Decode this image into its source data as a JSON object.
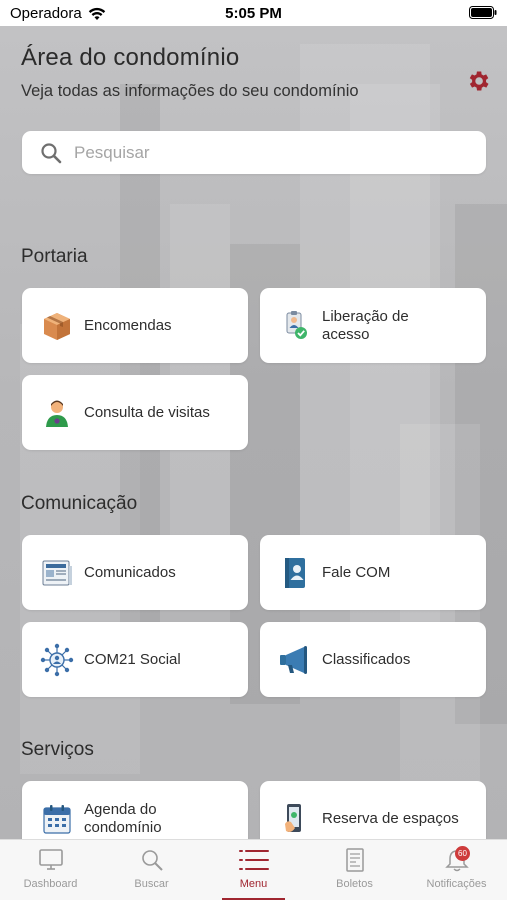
{
  "status_bar": {
    "carrier": "Operadora",
    "time": "5:05 PM"
  },
  "header": {
    "title": "Área do condomínio",
    "subtitle": "Veja todas as informações do seu condomínio"
  },
  "search": {
    "placeholder": "Pesquisar"
  },
  "sections": {
    "portaria": {
      "title": "Portaria",
      "items": [
        {
          "label": "Encomendas",
          "icon": "package-icon"
        },
        {
          "label": "Liberação de acesso",
          "icon": "access-badge-icon"
        },
        {
          "label": "Consulta de visitas",
          "icon": "visitor-icon"
        }
      ]
    },
    "comunicacao": {
      "title": "Comunicação",
      "items": [
        {
          "label": "Comunicados",
          "icon": "newspaper-icon"
        },
        {
          "label": "Fale COM",
          "icon": "contact-book-icon"
        },
        {
          "label": "COM21 Social",
          "icon": "social-network-icon"
        },
        {
          "label": "Classificados",
          "icon": "megaphone-icon"
        }
      ]
    },
    "servicos": {
      "title": "Serviços",
      "items": [
        {
          "label": "Agenda do condomínio",
          "icon": "calendar-icon"
        },
        {
          "label": "Reserva de espaços",
          "icon": "booking-icon"
        }
      ]
    }
  },
  "tabbar": {
    "tabs": [
      {
        "label": "Dashboard",
        "icon": "monitor-icon"
      },
      {
        "label": "Buscar",
        "icon": "search-icon"
      },
      {
        "label": "Menu",
        "icon": "menu-icon"
      },
      {
        "label": "Boletos",
        "icon": "bill-icon"
      },
      {
        "label": "Notificações",
        "icon": "bell-icon"
      }
    ],
    "active": "Menu",
    "notification_badge": "60"
  },
  "colors": {
    "accent": "#a02630",
    "background": "#b9b9bb",
    "card": "#ffffff"
  }
}
